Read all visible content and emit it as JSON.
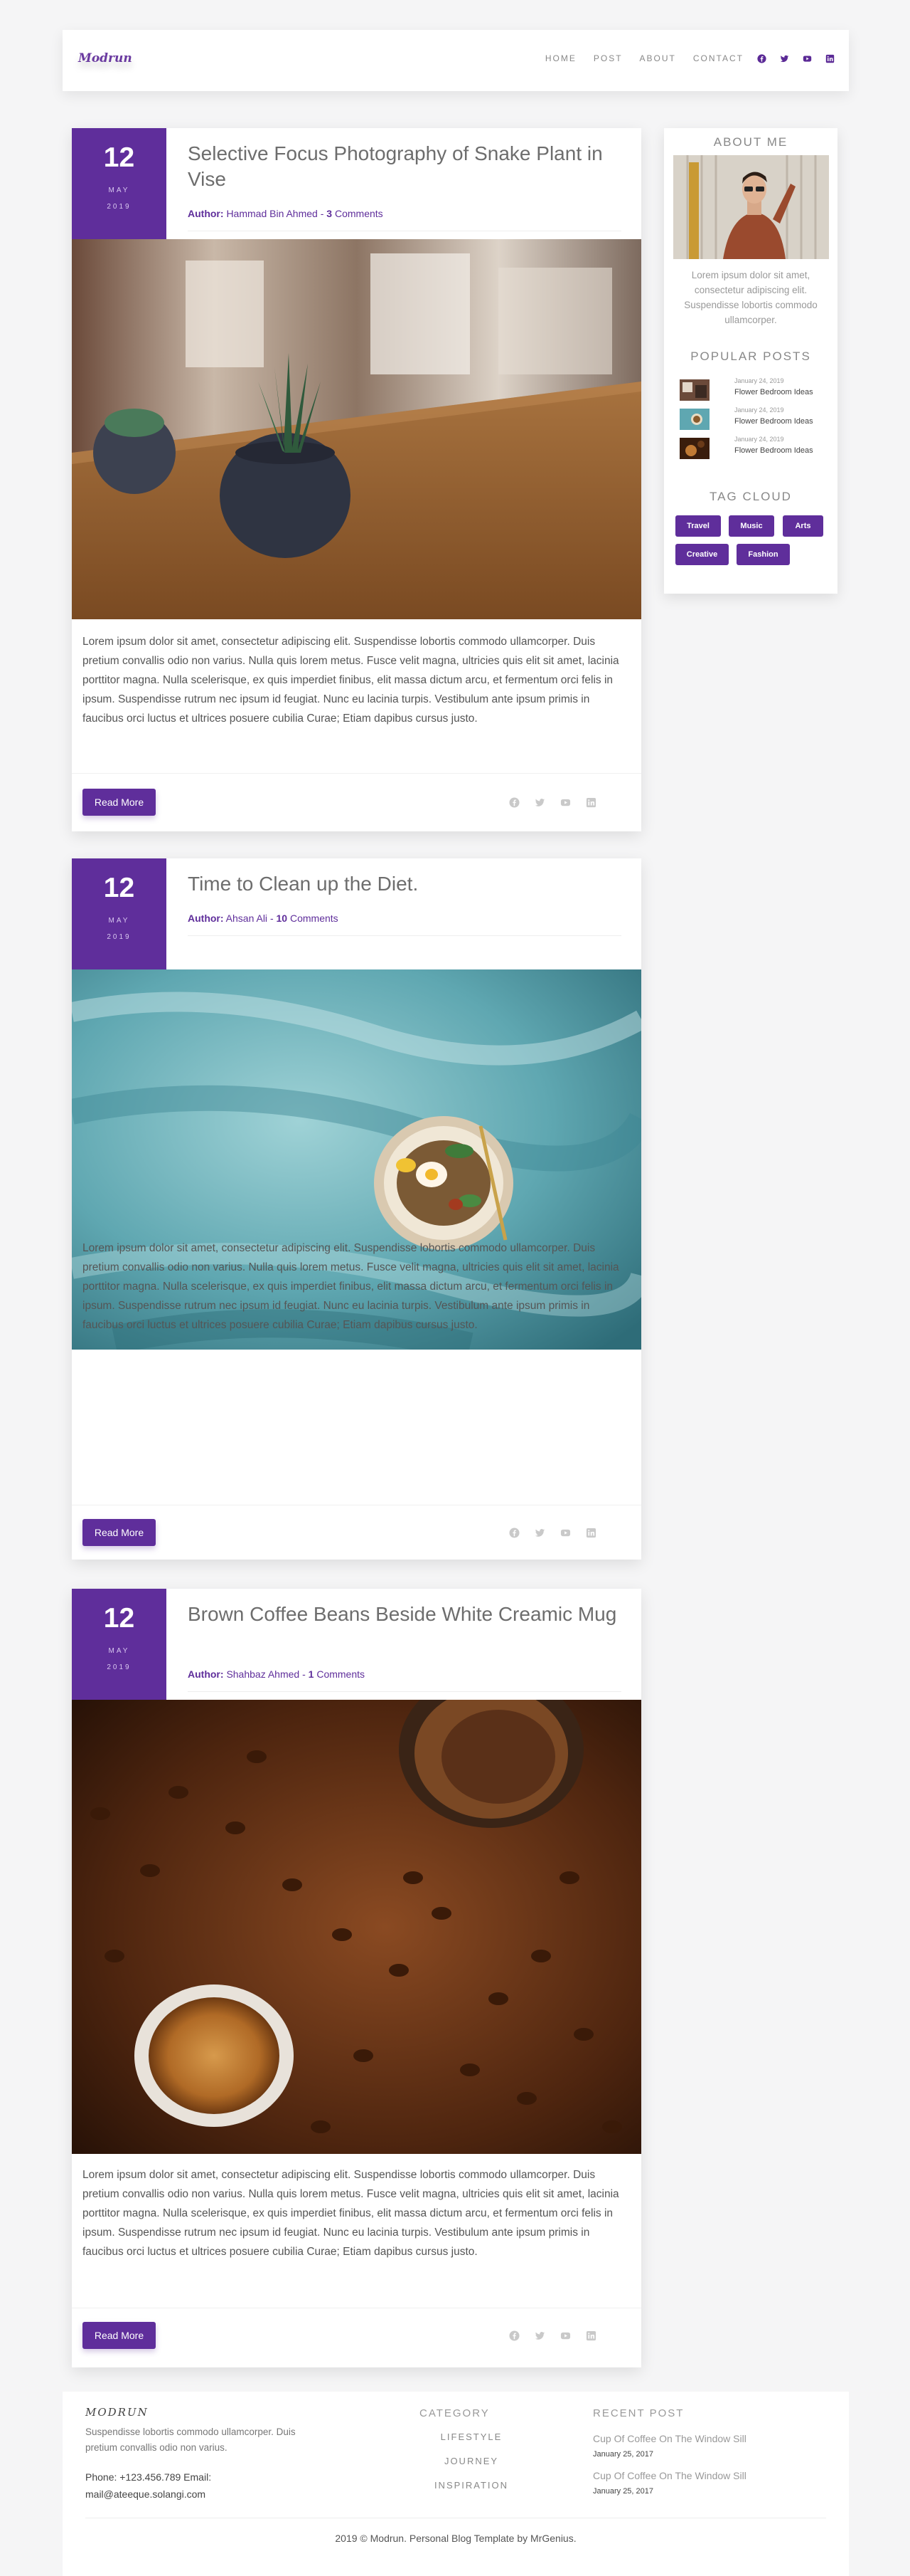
{
  "header": {
    "logo": "Modrun",
    "nav": [
      "HOME",
      "POST",
      "ABOUT",
      "CONTACT"
    ],
    "social_icons": [
      "facebook-icon",
      "twitter-icon",
      "youtube-icon",
      "linkedin-icon"
    ]
  },
  "posts": [
    {
      "day": "12",
      "month": "MAY",
      "year": "2019",
      "title": "Selective Focus Photography of Snake Plant in Vise",
      "author_label": "Author:",
      "author": "Hammad Bin Ahmed",
      "sep": "-",
      "comments_count": "3",
      "comments_label": "Comments",
      "excerpt": "Lorem ipsum dolor sit amet, consectetur adipiscing elit. Suspendisse lobortis commodo ullamcorper. Duis pretium convallis odio non varius. Nulla quis lorem metus. Fusce velit magna, ultricies quis elit sit amet, lacinia porttitor magna. Nulla scelerisque, ex quis imperdiet finibus, elit massa dictum arcu, et fermentum orci felis in ipsum. Suspendisse rutrum nec ipsum id feugiat. Nunc eu lacinia turpis. Vestibulum ante ipsum primis in faucibus orci luctus et ultrices posuere cubilia Curae; Etiam dapibus cursus justo.",
      "read_more": "Read More",
      "image": "snake-plant-photo"
    },
    {
      "day": "12",
      "month": "MAY",
      "year": "2019",
      "title": "Time to Clean up the Diet.",
      "author_label": "Author:",
      "author": "Ahsan Ali",
      "sep": "-",
      "comments_count": "10",
      "comments_label": "Comments",
      "excerpt": "Lorem ipsum dolor sit amet, consectetur adipiscing elit. Suspendisse lobortis commodo ullamcorper. Duis pretium convallis odio non varius. Nulla quis lorem metus. Fusce velit magna, ultricies quis elit sit amet, lacinia porttitor magna. Nulla scelerisque, ex quis imperdiet finibus, elit massa dictum arcu, et fermentum orci felis in ipsum. Suspendisse rutrum nec ipsum id feugiat. Nunc eu lacinia turpis. Vestibulum ante ipsum primis in faucibus orci luctus et ultrices posuere cubilia Curae; Etiam dapibus cursus justo.",
      "read_more": "Read More",
      "image": "food-plate-photo"
    },
    {
      "day": "12",
      "month": "MAY",
      "year": "2019",
      "title": "Brown Coffee Beans Beside White Creamic Mug",
      "author_label": "Author:",
      "author": "Shahbaz Ahmed",
      "sep": "-",
      "comments_count": "1",
      "comments_label": "Comments",
      "excerpt": "Lorem ipsum dolor sit amet, consectetur adipiscing elit. Suspendisse lobortis commodo ullamcorper. Duis pretium convallis odio non varius. Nulla quis lorem metus. Fusce velit magna, ultricies quis elit sit amet, lacinia porttitor magna. Nulla scelerisque, ex quis imperdiet finibus, elit massa dictum arcu, et fermentum orci felis in ipsum. Suspendisse rutrum nec ipsum id feugiat. Nunc eu lacinia turpis. Vestibulum ante ipsum primis in faucibus orci luctus et ultrices posuere cubilia Curae; Etiam dapibus cursus justo.",
      "read_more": "Read More",
      "image": "coffee-beans-photo"
    }
  ],
  "share_icons": [
    "facebook-icon",
    "twitter-icon",
    "youtube-icon",
    "linkedin-icon"
  ],
  "sidebar": {
    "about_heading": "ABOUT ME",
    "about_text": "Lorem ipsum dolor sit amet, consectetur adipiscing elit. Suspendisse lobortis commodo ullamcorper.",
    "popular_heading": "POPULAR POSTS",
    "popular": [
      {
        "date": "January 24, 2019",
        "title": "Flower Bedroom Ideas"
      },
      {
        "date": "January 24, 2019",
        "title": "Flower Bedroom Ideas"
      },
      {
        "date": "January 24, 2019",
        "title": "Flower Bedroom Ideas"
      }
    ],
    "tag_heading": "TAG CLOUD",
    "tags": [
      "Travel",
      "Music",
      "Arts",
      "Creative",
      "Fashion"
    ]
  },
  "footer": {
    "logo": "MODRUN",
    "description": "Suspendisse lobortis commodo ullamcorper. Duis pretium convallis odio non varius.",
    "phone": "Phone: +123.456.789 Email:",
    "email": "mail@ateeque.solangi.com",
    "category_heading": "CATEGORY",
    "categories": [
      "LIFESTYLE",
      "JOURNEY",
      "INSPIRATION"
    ],
    "recent_heading": "RECENT POST",
    "recent": [
      {
        "title": "Cup Of Coffee On The Window Sill",
        "date": "January 25, 2017"
      },
      {
        "title": "Cup Of Coffee On The Window Sill",
        "date": "January 25, 2017"
      }
    ],
    "copyright": "2019 © Modrun. Personal Blog Template by MrGenius."
  },
  "colors": {
    "accent": "#5f2e9b",
    "background": "#f5f5f6"
  }
}
